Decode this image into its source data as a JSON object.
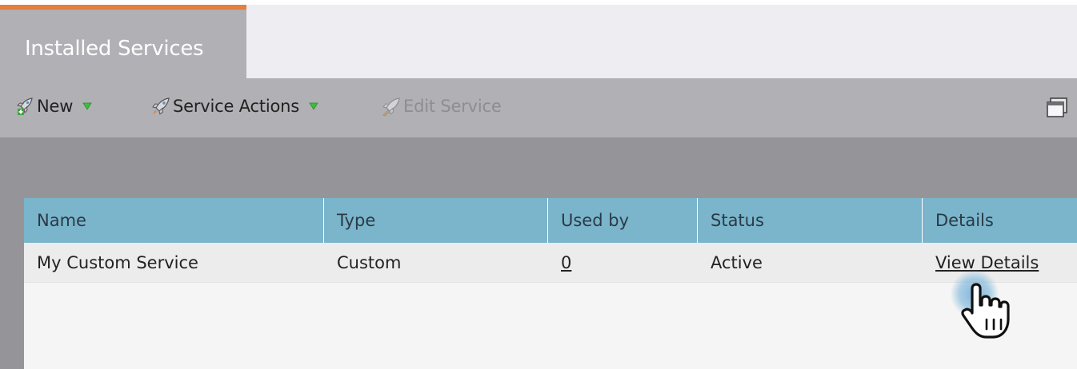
{
  "tabs": [
    {
      "label": "Installed Services",
      "active": true
    }
  ],
  "toolbar": {
    "new_label": "New",
    "service_actions_label": "Service Actions",
    "edit_service_label": "Edit Service"
  },
  "table": {
    "columns": [
      "Name",
      "Type",
      "Used by",
      "Status",
      "Details"
    ],
    "rows": [
      {
        "name": "My Custom Service",
        "type": "Custom",
        "used_by": "0",
        "status": "Active",
        "details": "View Details"
      }
    ]
  },
  "colors": {
    "tab_accent": "#e67e3c",
    "toolbar_bg": "#b1b0b5",
    "header_bg": "#7ab5cc",
    "caret_green": "#3cbf3c"
  },
  "icons": {
    "new": "rocket-plus-icon",
    "service_actions": "rocket-icon",
    "edit_service": "rocket-edit-icon",
    "window": "restore-window-icon",
    "cursor": "hand-pointer-icon"
  }
}
